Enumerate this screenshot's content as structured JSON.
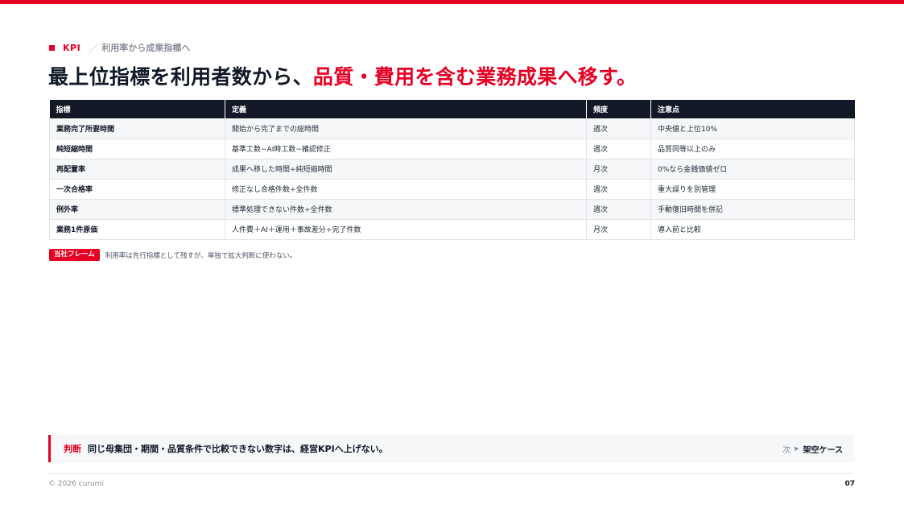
{
  "kicker": {
    "label": "KPI",
    "separator": "／",
    "sub": "利用率から成果指標へ"
  },
  "headline": {
    "plain": "最上位指標を利用者数から、",
    "accent": "品質・費用を含む業務成果へ移す。"
  },
  "table": {
    "headers": [
      "指標",
      "定義",
      "頻度",
      "注意点"
    ],
    "rows": [
      [
        "業務完了所要時間",
        "開始から完了までの総時間",
        "週次",
        "中央値と上位10%"
      ],
      [
        "純短縮時間",
        "基準工数−AI時工数−確認修正",
        "週次",
        "品質同等以上のみ"
      ],
      [
        "再配置率",
        "成果へ移した時間÷純短縮時間",
        "月次",
        "0%なら金銭価値ゼロ"
      ],
      [
        "一次合格率",
        "修正なし合格件数÷全件数",
        "週次",
        "重大誤りを別管理"
      ],
      [
        "例外率",
        "標準処理できない件数÷全件数",
        "週次",
        "手動復旧時間を併記"
      ],
      [
        "業務1件原価",
        "人件費＋AI＋運用＋事故差分÷完了件数",
        "月次",
        "導入前と比較"
      ]
    ]
  },
  "note": {
    "badge": "当社フレーム",
    "text": "利用率は先行指標として残すが、単独で拡大判断に使わない。"
  },
  "verdict": {
    "label": "判断",
    "text": "同じ母集団・期間・品質条件で比較できない数字は、経営KPIへ上げない。",
    "next_label": "次",
    "next_arrow": "▶",
    "next_target": "架空ケース"
  },
  "footer": {
    "copyright": "© 2026 curumi",
    "page": "07"
  },
  "colors": {
    "accent": "#e60023",
    "header_bg": "#121826"
  }
}
